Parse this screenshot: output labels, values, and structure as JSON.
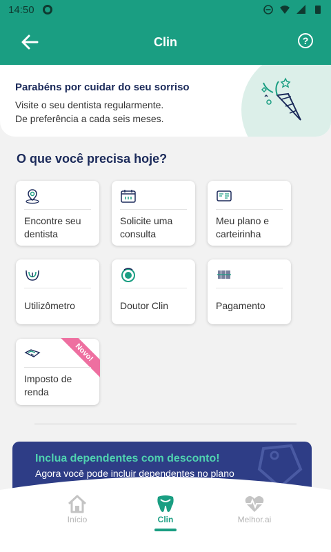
{
  "status_bar": {
    "time": "14:50"
  },
  "app_bar": {
    "title": "Clin",
    "help_symbol": "?"
  },
  "banner": {
    "headline": "Parabéns por cuidar do seu sorriso",
    "line1": "Visite o seu dentista regularmente.",
    "line2": "De preferência a cada seis meses."
  },
  "section": {
    "title": "O que você precisa hoje?"
  },
  "cards": [
    {
      "label": "Encontre seu dentista",
      "icon": "location-pin-icon"
    },
    {
      "label": "Solicite uma consulta",
      "icon": "calendar-icon"
    },
    {
      "label": "Meu plano e carteirinha",
      "icon": "id-card-icon"
    },
    {
      "label": "Utilizômetro",
      "icon": "gauge-icon"
    },
    {
      "label": "Doutor Clin",
      "icon": "doutor-clin-icon"
    },
    {
      "label": "Pagamento",
      "icon": "barcode-icon"
    },
    {
      "label": "Imposto de renda",
      "icon": "tax-document-icon",
      "badge": "Novo!"
    }
  ],
  "promo": {
    "title": "Inclua dependentes com desconto!",
    "subtitle": "Agora você pode incluir dependentes no plano"
  },
  "bottom_nav": [
    {
      "label": "Início",
      "icon": "home-icon"
    },
    {
      "label": "Clin",
      "icon": "tooth-icon",
      "active": true
    },
    {
      "label": "Melhor.ai",
      "icon": "heart-pulse-icon"
    }
  ],
  "colors": {
    "primary": "#1a9e82",
    "navy": "#1b2a5a",
    "badge": "#ee6fa0",
    "promo_bg": "#2e3d86",
    "promo_title": "#4fd3b0"
  }
}
